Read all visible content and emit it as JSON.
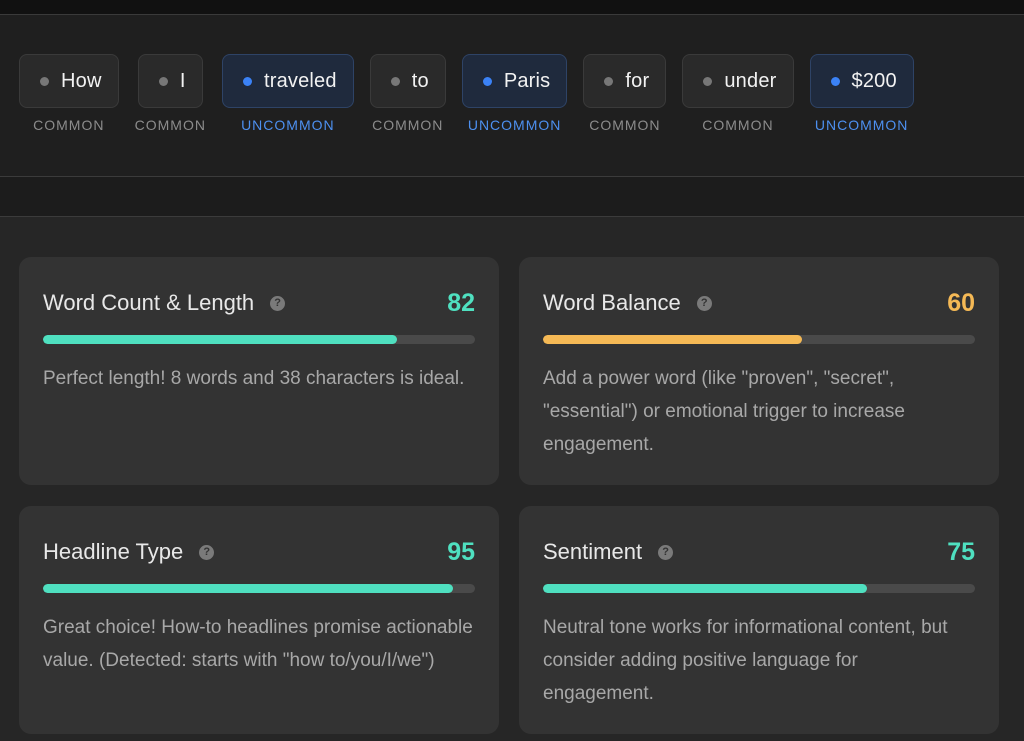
{
  "tokens": [
    {
      "word": "How",
      "tag": "COMMON",
      "kind": "common"
    },
    {
      "word": "I",
      "tag": "COMMON",
      "kind": "common"
    },
    {
      "word": "traveled",
      "tag": "UNCOMMON",
      "kind": "uncommon"
    },
    {
      "word": "to",
      "tag": "COMMON",
      "kind": "common"
    },
    {
      "word": "Paris",
      "tag": "UNCOMMON",
      "kind": "uncommon"
    },
    {
      "word": "for",
      "tag": "COMMON",
      "kind": "common"
    },
    {
      "word": "under",
      "tag": "COMMON",
      "kind": "common"
    },
    {
      "word": "$200",
      "tag": "UNCOMMON",
      "kind": "uncommon"
    }
  ],
  "colors": {
    "teal": "#4fe0c0",
    "amber": "#f5b955",
    "uncommon_blue": "#3b82f6"
  },
  "cards": [
    {
      "title": "Word Count & Length",
      "score": "82",
      "progress": 0.82,
      "color": "#4fe0c0",
      "description": "Perfect length! 8 words and 38 characters is ideal."
    },
    {
      "title": "Word Balance",
      "score": "60",
      "progress": 0.6,
      "color": "#f5b955",
      "description": "Add a power word (like \"proven\", \"secret\", \"essential\") or emotional trigger to increase engagement."
    },
    {
      "title": "Headline Type",
      "score": "95",
      "progress": 0.95,
      "color": "#4fe0c0",
      "description": "Great choice! How-to headlines promise actionable value. (Detected: starts with \"how to/you/I/we\")"
    },
    {
      "title": "Sentiment",
      "score": "75",
      "progress": 0.75,
      "color": "#4fe0c0",
      "description": "Neutral tone works for informational content, but consider adding positive language for engagement."
    }
  ],
  "help_icon": "question-circle-icon",
  "help_glyph": "?"
}
